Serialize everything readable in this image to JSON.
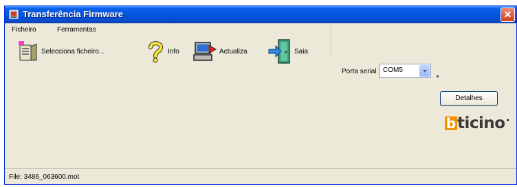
{
  "window": {
    "title": "Transferência Firmware",
    "close_label": "✕"
  },
  "menu": {
    "items": [
      "Ficheiro",
      "Ferramentas"
    ]
  },
  "toolbar": {
    "select_file_label": "Selecciona ficheiro...",
    "info_label": "Info",
    "update_label": "Actualiza",
    "exit_label": "Saia",
    "port_label": "Porta serial",
    "port_value": "COM5"
  },
  "details_button": "Detalhes",
  "logo": {
    "first_letter": "b",
    "rest": "ticino"
  },
  "statusbar": {
    "text": "File: 3486_063600.mot"
  },
  "icons": {
    "title": "app-icon",
    "select_file": "open-file-icon",
    "info": "question-mark-icon",
    "update": "computer-upload-icon",
    "exit": "exit-door-icon"
  },
  "colors": {
    "titlebar": "#0553dd",
    "logo_accent": "#f39200",
    "close": "#d6431c"
  }
}
